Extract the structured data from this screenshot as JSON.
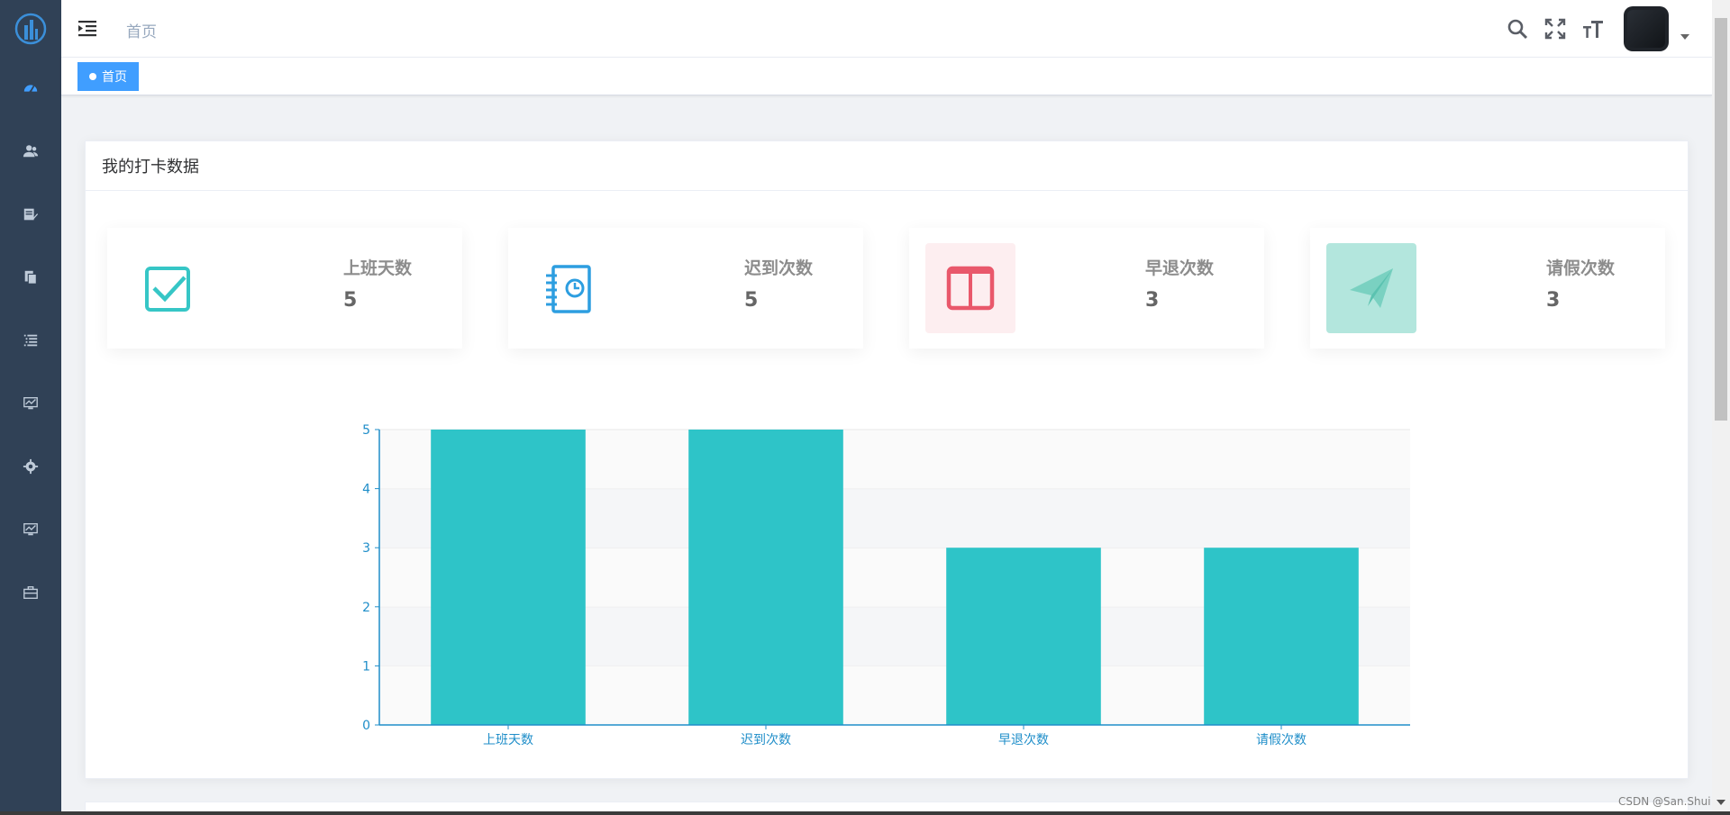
{
  "navbar": {
    "breadcrumb": "首页"
  },
  "tags": {
    "active": "首页"
  },
  "sidebar": {
    "items": [
      {
        "icon": "dashboard-icon"
      },
      {
        "icon": "users-icon"
      },
      {
        "icon": "edit-document-icon"
      },
      {
        "icon": "copy-document-icon"
      },
      {
        "icon": "list-icon"
      },
      {
        "icon": "monitor-chart-icon"
      },
      {
        "icon": "gear-icon"
      },
      {
        "icon": "monitor-chart-icon"
      },
      {
        "icon": "briefcase-icon"
      }
    ]
  },
  "card": {
    "title": "我的打卡数据"
  },
  "stats": [
    {
      "label": "上班天数",
      "value": "5",
      "icon": "checkbox-icon",
      "color": "#36c6c6",
      "bg": "#ffffff"
    },
    {
      "label": "迟到次数",
      "value": "5",
      "icon": "clock-document-icon",
      "color": "#2d9ee0",
      "bg": "#ffffff"
    },
    {
      "label": "早退次数",
      "value": "3",
      "icon": "book-icon",
      "color": "#e9586b",
      "bg": "#fdeef0"
    },
    {
      "label": "请假次数",
      "value": "3",
      "icon": "paper-plane-icon",
      "color": "#ffffff",
      "bg": "#b3e6dd"
    }
  ],
  "chart_data": {
    "type": "bar",
    "categories": [
      "上班天数",
      "迟到次数",
      "早退次数",
      "请假次数"
    ],
    "values": [
      5,
      5,
      3,
      3
    ],
    "ylim": [
      0,
      5
    ],
    "yticks": [
      "0",
      "1",
      "2",
      "3",
      "4",
      "5"
    ],
    "bar_color": "#2ec4c8",
    "axis_color": "#1f8ec9",
    "grid": true
  },
  "watermark": "CSDN @San.Shui"
}
